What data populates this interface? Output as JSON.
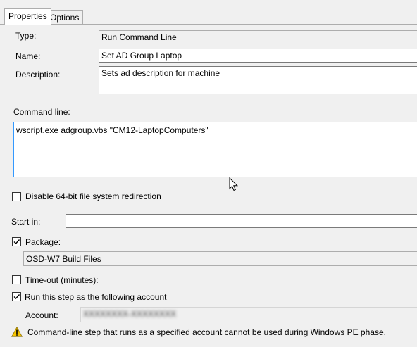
{
  "tabs": [
    {
      "label": "Properties",
      "active": true
    },
    {
      "label": "Options",
      "active": false
    }
  ],
  "properties": {
    "type_label": "Type:",
    "type_value": "Run Command Line",
    "name_label": "Name:",
    "name_value": "Set AD Group Laptop",
    "description_label": "Description:",
    "description_value": "Sets ad description for machine",
    "command_line_label": "Command line:",
    "command_line_value": "wscript.exe adgroup.vbs \"CM12-LaptopComputers\"",
    "disable_redirection_label": "Disable 64-bit file system redirection",
    "disable_redirection_checked": false,
    "start_in_label": "Start in:",
    "start_in_value": "",
    "package_label": "Package:",
    "package_checked": true,
    "package_value": "OSD-W7 Build Files",
    "timeout_label": "Time-out (minutes):",
    "timeout_checked": false,
    "run_as_label": "Run this step as the following account",
    "run_as_checked": true,
    "account_label": "Account:",
    "account_value": "XXXXXXXX-XXXXXXXX",
    "warning_text": "Command-line step that runs as a specified account cannot be used during Windows PE phase."
  },
  "icons": {
    "warning": "warning-icon",
    "cursor": "mouse-pointer-icon",
    "checkmark": "checkmark-icon"
  },
  "colors": {
    "background": "#f0f0f0",
    "field_border": "#7a7a7a",
    "focus_border": "#3399ff",
    "warning_fill": "#f5c400"
  }
}
